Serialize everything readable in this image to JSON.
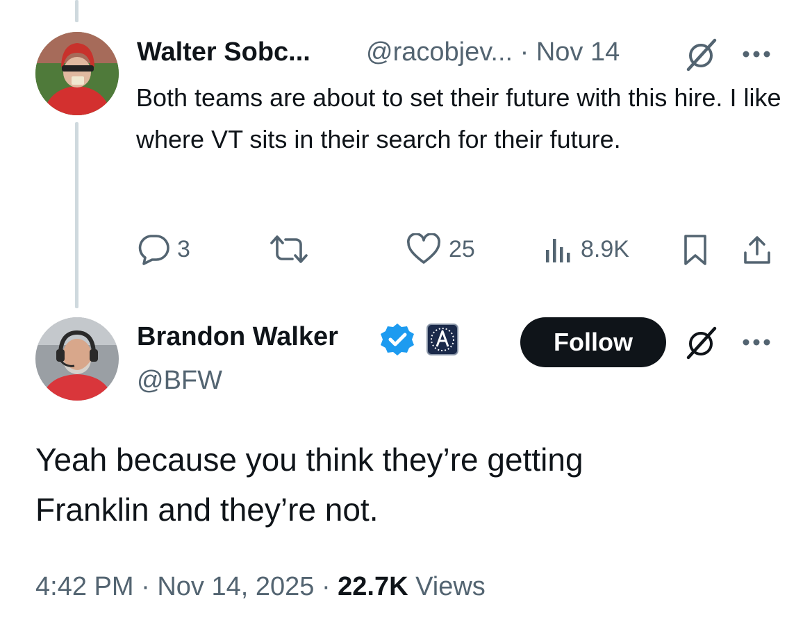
{
  "reply": {
    "author_name": "Walter Sobc...",
    "handle": "@racobjev...",
    "separator": "·",
    "date": "Nov 14",
    "text": "Both teams are about to set their future with this hire. I like where VT sits in their search for their future.",
    "actions": {
      "replies": "3",
      "retweets": "",
      "likes": "25",
      "views": "8.9K"
    },
    "icons": [
      "grok-icon",
      "more-icon",
      "reply-icon",
      "retweet-icon",
      "like-icon",
      "views-icon",
      "bookmark-icon",
      "share-icon"
    ]
  },
  "main_tweet": {
    "author_name": "Brandon Walker",
    "handle": "@BFW",
    "follow_label": "Follow",
    "text_line1": "Yeah because you think they’re getting",
    "text_line2": "Franklin and they’re not.",
    "time": "4:42 PM",
    "sep1": "·",
    "date": "Nov 14, 2025",
    "sep2": "·",
    "views_count": "22.7K",
    "views_label": "Views",
    "affiliate_badge": "barstool-badge",
    "verified": true
  },
  "colors": {
    "text": "#0f1419",
    "muted": "#536471",
    "verified_blue": "#1d9bf0",
    "thread_line": "#cfd9de",
    "follow_bg": "#0f1419"
  }
}
